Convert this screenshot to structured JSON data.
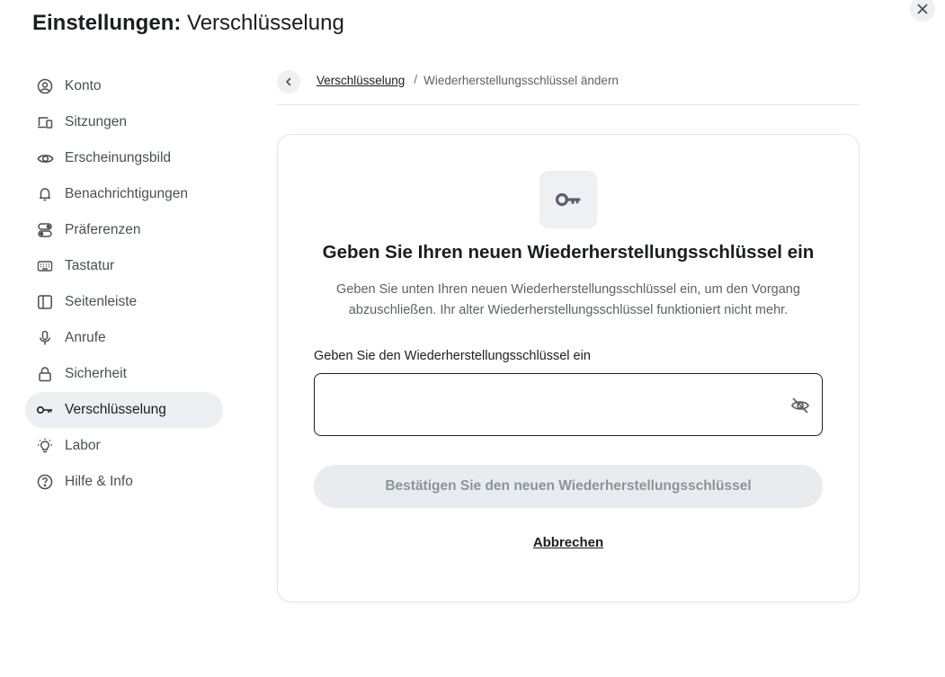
{
  "window": {
    "close_icon": "close-icon"
  },
  "header": {
    "title_strong": "Einstellungen:",
    "title_rest": "Verschlüsselung"
  },
  "sidebar": {
    "items": [
      {
        "label": "Konto",
        "icon": "user-circle-icon",
        "active": false
      },
      {
        "label": "Sitzungen",
        "icon": "devices-icon",
        "active": false
      },
      {
        "label": "Erscheinungsbild",
        "icon": "eye-icon",
        "active": false
      },
      {
        "label": "Benachrichtigungen",
        "icon": "bell-icon",
        "active": false
      },
      {
        "label": "Präferenzen",
        "icon": "toggles-icon",
        "active": false
      },
      {
        "label": "Tastatur",
        "icon": "keyboard-icon",
        "active": false
      },
      {
        "label": "Seitenleiste",
        "icon": "sidebar-icon",
        "active": false
      },
      {
        "label": "Anrufe",
        "icon": "microphone-icon",
        "active": false
      },
      {
        "label": "Sicherheit",
        "icon": "lock-icon",
        "active": false
      },
      {
        "label": "Verschlüsselung",
        "icon": "key-icon",
        "active": true
      },
      {
        "label": "Labor",
        "icon": "lightbulb-icon",
        "active": false
      },
      {
        "label": "Hilfe & Info",
        "icon": "help-circle-icon",
        "active": false
      }
    ]
  },
  "breadcrumb": {
    "back_icon": "chevron-left-icon",
    "parent": "Verschlüsselung",
    "separator": "/",
    "current": "Wiederherstellungsschlüssel ändern"
  },
  "card": {
    "icon": "key-icon",
    "title": "Geben Sie Ihren neuen Wiederherstellungsschlüssel ein",
    "description": "Geben Sie unten Ihren neuen Wiederherstellungsschlüssel ein, um den Vorgang abzuschließen. Ihr alter Wiederherstellungsschlüssel funktioniert nicht mehr.",
    "field_label": "Geben Sie den Wiederherstellungsschlüssel ein",
    "field_value": "",
    "visibility_icon": "eye-off-icon",
    "confirm_label": "Bestätigen Sie den neuen Wiederherstellungsschlüssel",
    "confirm_disabled": true,
    "cancel_label": "Abbrechen"
  },
  "colors": {
    "text": "#1b1d22",
    "muted": "#5d6169",
    "active_bg": "#eceef1",
    "disabled_bg": "#e9ecef",
    "disabled_text": "#8d929a",
    "border": "#e3e6ea"
  }
}
